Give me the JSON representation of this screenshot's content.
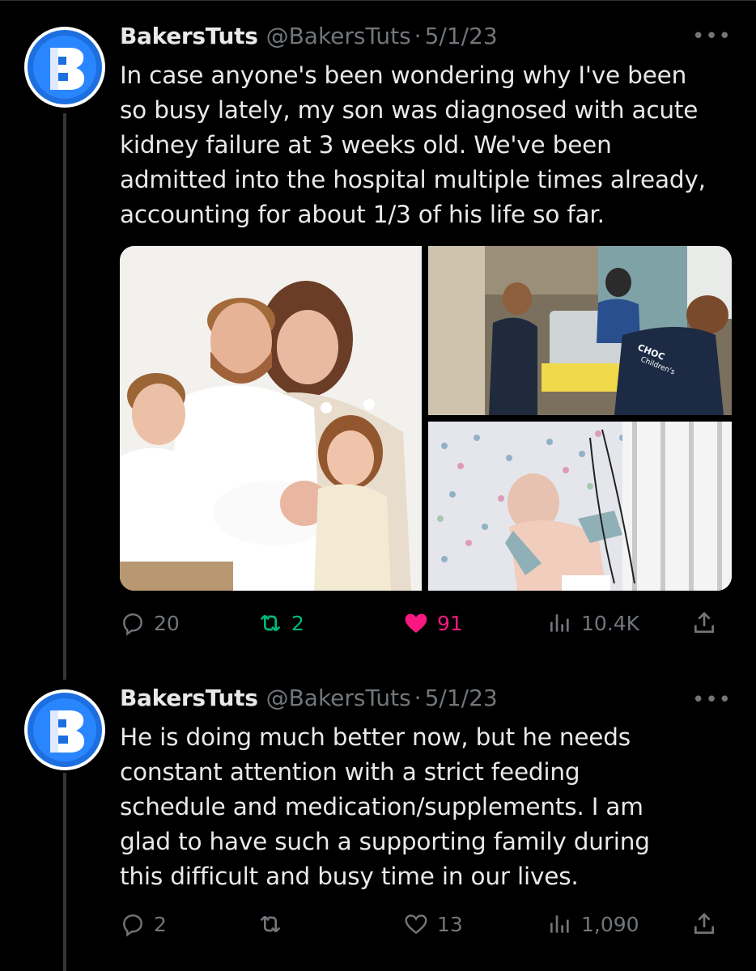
{
  "colors": {
    "background": "#000000",
    "text": "#e7e9ea",
    "muted": "#71767b",
    "retweet_active": "#00ba7c",
    "like_active": "#f91880",
    "avatar_blue": "#1d6fe0"
  },
  "tweets": [
    {
      "display_name": "BakersTuts",
      "handle": "@BakersTuts",
      "separator": "·",
      "date": "5/1/23",
      "text": "In case anyone's been wondering why I've been\nso busy lately, my son was diagnosed with acute\nkidney failure at 3 weeks old. We've been\nadmitted into the hospital multiple times already,\naccounting for about 1/3 of his life so far.",
      "more_icon": "more-horizontal-icon",
      "media": [
        {
          "icon": "family-photo"
        },
        {
          "icon": "hospital-team-photo",
          "visible_text": "CHOC Children's"
        },
        {
          "icon": "infant-in-crib-photo"
        }
      ],
      "metrics": {
        "replies": "20",
        "retweets": "2",
        "likes": "91",
        "views": "10.4K"
      },
      "retweet_active": true,
      "like_active": true
    },
    {
      "display_name": "BakersTuts",
      "handle": "@BakersTuts",
      "separator": "·",
      "date": "5/1/23",
      "text": "He is doing much better now, but he needs\nconstant attention with a strict feeding\nschedule and medication/supplements. I am\nglad to have such a supporting family during\nthis difficult and busy time in our lives.",
      "more_icon": "more-horizontal-icon",
      "metrics": {
        "replies": "2",
        "retweets": "",
        "likes": "13",
        "views": "1,090"
      },
      "retweet_active": false,
      "like_active": false
    }
  ]
}
